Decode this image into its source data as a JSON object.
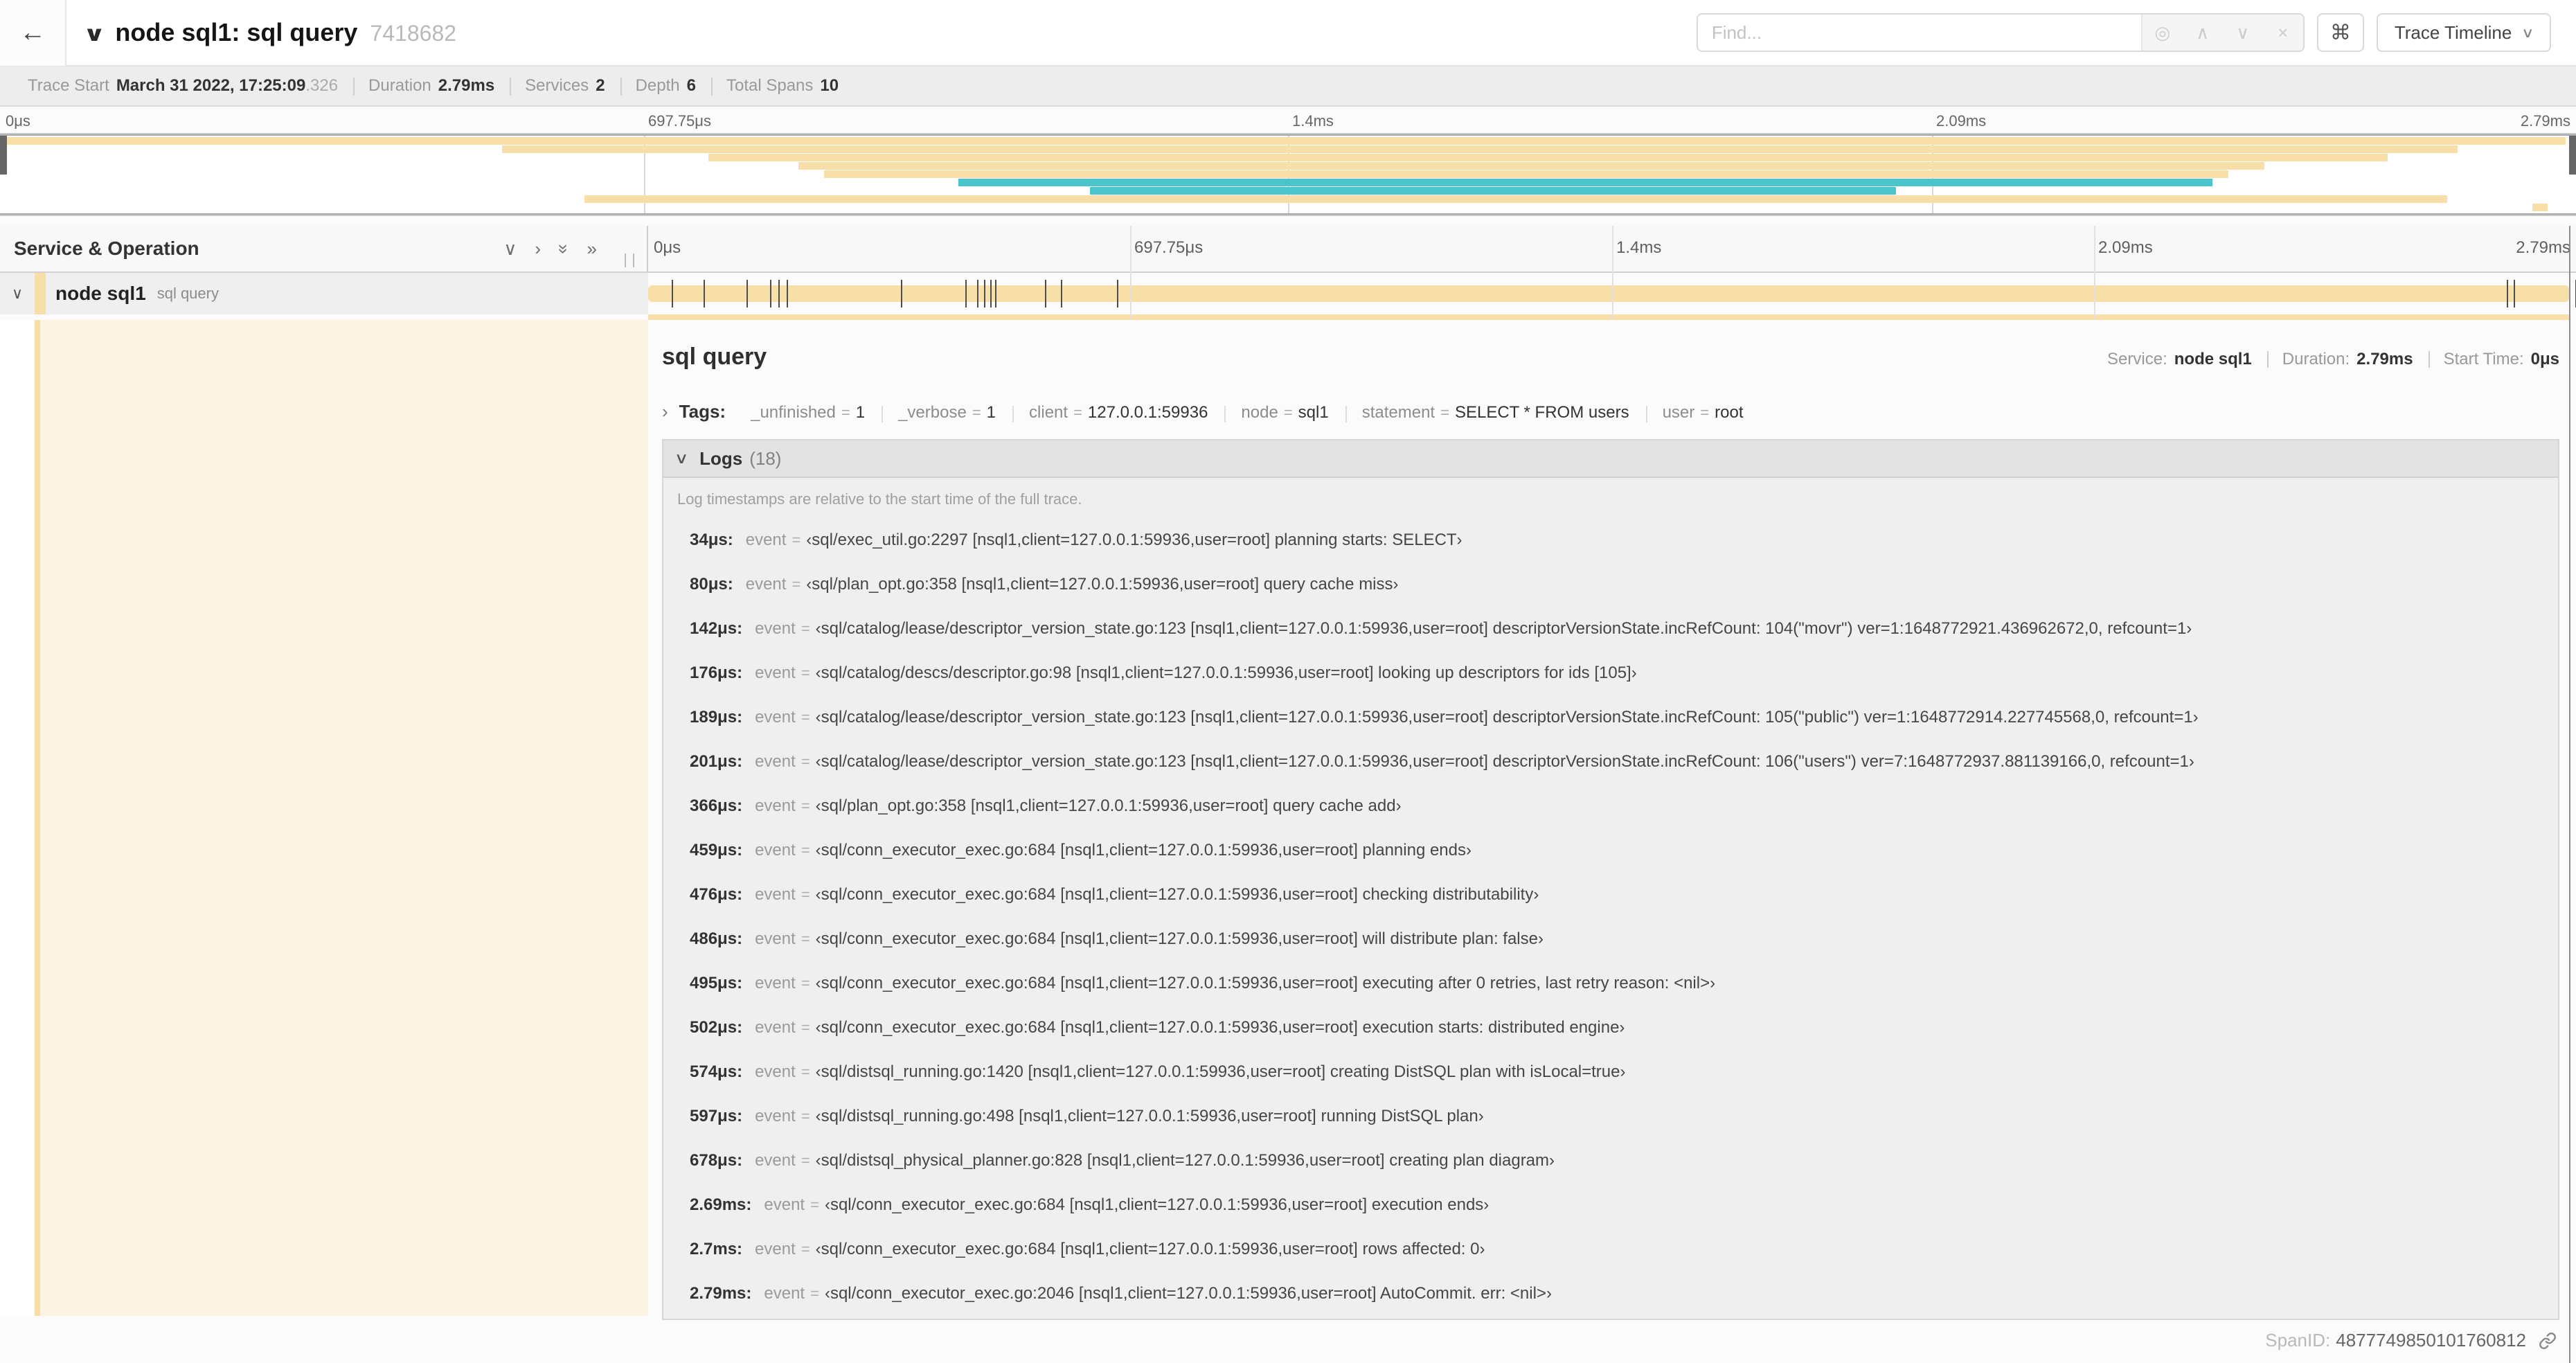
{
  "colors": {
    "tan": "#F8DEA8",
    "teal": "#49C5CB",
    "cream": "#FCF4E2"
  },
  "icons": {
    "back": "←",
    "title_collapse": "∨",
    "dropdown_chevron": "∨",
    "find_target": "◎",
    "find_prev": "∧",
    "find_next": "∨",
    "find_clear": "×",
    "shortcut": "⌘",
    "collapse_one": "∨",
    "expand_one": "›",
    "collapse_all": "»",
    "expand_all": "»",
    "row_chevron": "∨",
    "tags_chevron": "›",
    "logs_chevron": "∨",
    "log_chevron": "›"
  },
  "topbar": {
    "title": "node sql1: sql query",
    "trace_id": "7418682",
    "find_placeholder": "Find...",
    "view_selector": "Trace Timeline"
  },
  "stats": [
    {
      "label": "Trace Start",
      "value": "March 31 2022, 17:25:09",
      "suffix": ".326"
    },
    {
      "label": "Duration",
      "value": "2.79ms"
    },
    {
      "label": "Services",
      "value": "2"
    },
    {
      "label": "Depth",
      "value": "6"
    },
    {
      "label": "Total Spans",
      "value": "10"
    }
  ],
  "minimap": {
    "ticks": [
      {
        "label": "0μs",
        "pos": 0
      },
      {
        "label": "697.75μs",
        "pos": 25
      },
      {
        "label": "1.4ms",
        "pos": 50
      },
      {
        "label": "2.09ms",
        "pos": 75
      },
      {
        "label": "2.79ms",
        "pos": 100
      }
    ],
    "spans": [
      {
        "start": 0,
        "end": 99.6,
        "color": "tan"
      },
      {
        "start": 19.5,
        "end": 95.4,
        "color": "tan"
      },
      {
        "start": 27.5,
        "end": 92.7,
        "color": "tan"
      },
      {
        "start": 31.0,
        "end": 87.9,
        "color": "tan"
      },
      {
        "start": 32.0,
        "end": 86.5,
        "color": "tan"
      },
      {
        "start": 37.2,
        "end": 85.9,
        "color": "teal"
      },
      {
        "start": 42.3,
        "end": 73.6,
        "color": "teal"
      },
      {
        "start": 22.7,
        "end": 95.0,
        "color": "tan"
      },
      {
        "start": 98.3,
        "end": 98.9,
        "color": "tan"
      }
    ]
  },
  "grid": {
    "header": "Service & Operation"
  },
  "ruler": {
    "ticks": [
      {
        "label": "0μs",
        "pos": 0
      },
      {
        "label": "697.75μs",
        "pos": 25
      },
      {
        "label": "1.4ms",
        "pos": 50
      },
      {
        "label": "2.09ms",
        "pos": 75
      },
      {
        "label": "2.79ms",
        "pos": 100
      }
    ]
  },
  "row": {
    "service": "node sql1",
    "operation": "sql query"
  },
  "log_marks": [
    1.22,
    2.87,
    5.09,
    6.31,
    6.77,
    7.2,
    13.12,
    16.45,
    17.06,
    17.42,
    17.74,
    17.99,
    20.57,
    21.4,
    24.3,
    96.42,
    96.77,
    99.95
  ],
  "detail": {
    "title": "sql query",
    "overview": [
      {
        "label": "Service:",
        "value": "node sql1"
      },
      {
        "label": "Duration:",
        "value": "2.79ms"
      },
      {
        "label": "Start Time:",
        "value": "0μs"
      }
    ],
    "tags_label": "Tags:",
    "tags": [
      {
        "key": "_unfinished",
        "eq": "=",
        "value": "1"
      },
      {
        "key": "_verbose",
        "eq": "=",
        "value": "1"
      },
      {
        "key": "client",
        "eq": "=",
        "value": "127.0.0.1:59936"
      },
      {
        "key": "node",
        "eq": "=",
        "value": "sql1"
      },
      {
        "key": "statement",
        "eq": "=",
        "value": "SELECT * FROM users"
      },
      {
        "key": "user",
        "eq": "=",
        "value": "root"
      }
    ],
    "logs_label": "Logs",
    "logs_count": "(18)",
    "logs": [
      {
        "time": "34μs:",
        "key": "event",
        "eq": "=",
        "value": "‹sql/exec_util.go:2297 [nsql1,client=127.0.0.1:59936,user=root] planning starts: SELECT›"
      },
      {
        "time": "80μs:",
        "key": "event",
        "eq": "=",
        "value": "‹sql/plan_opt.go:358 [nsql1,client=127.0.0.1:59936,user=root] query cache miss›"
      },
      {
        "time": "142μs:",
        "key": "event",
        "eq": "=",
        "value": "‹sql/catalog/lease/descriptor_version_state.go:123 [nsql1,client=127.0.0.1:59936,user=root] descriptorVersionState.incRefCount: 104(\"movr\") ver=1:1648772921.436962672,0, refcount=1›"
      },
      {
        "time": "176μs:",
        "key": "event",
        "eq": "=",
        "value": "‹sql/catalog/descs/descriptor.go:98 [nsql1,client=127.0.0.1:59936,user=root] looking up descriptors for ids [105]›"
      },
      {
        "time": "189μs:",
        "key": "event",
        "eq": "=",
        "value": "‹sql/catalog/lease/descriptor_version_state.go:123 [nsql1,client=127.0.0.1:59936,user=root] descriptorVersionState.incRefCount: 105(\"public\") ver=1:1648772914.227745568,0, refcount=1›"
      },
      {
        "time": "201μs:",
        "key": "event",
        "eq": "=",
        "value": "‹sql/catalog/lease/descriptor_version_state.go:123 [nsql1,client=127.0.0.1:59936,user=root] descriptorVersionState.incRefCount: 106(\"users\") ver=7:1648772937.881139166,0, refcount=1›"
      },
      {
        "time": "366μs:",
        "key": "event",
        "eq": "=",
        "value": "‹sql/plan_opt.go:358 [nsql1,client=127.0.0.1:59936,user=root] query cache add›"
      },
      {
        "time": "459μs:",
        "key": "event",
        "eq": "=",
        "value": "‹sql/conn_executor_exec.go:684 [nsql1,client=127.0.0.1:59936,user=root] planning ends›"
      },
      {
        "time": "476μs:",
        "key": "event",
        "eq": "=",
        "value": "‹sql/conn_executor_exec.go:684 [nsql1,client=127.0.0.1:59936,user=root] checking distributability›"
      },
      {
        "time": "486μs:",
        "key": "event",
        "eq": "=",
        "value": "‹sql/conn_executor_exec.go:684 [nsql1,client=127.0.0.1:59936,user=root] will distribute plan: false›"
      },
      {
        "time": "495μs:",
        "key": "event",
        "eq": "=",
        "value": "‹sql/conn_executor_exec.go:684 [nsql1,client=127.0.0.1:59936,user=root] executing after 0 retries, last retry reason: <nil>›"
      },
      {
        "time": "502μs:",
        "key": "event",
        "eq": "=",
        "value": "‹sql/conn_executor_exec.go:684 [nsql1,client=127.0.0.1:59936,user=root] execution starts: distributed engine›"
      },
      {
        "time": "574μs:",
        "key": "event",
        "eq": "=",
        "value": "‹sql/distsql_running.go:1420 [nsql1,client=127.0.0.1:59936,user=root] creating DistSQL plan with isLocal=true›"
      },
      {
        "time": "597μs:",
        "key": "event",
        "eq": "=",
        "value": "‹sql/distsql_running.go:498 [nsql1,client=127.0.0.1:59936,user=root] running DistSQL plan›"
      },
      {
        "time": "678μs:",
        "key": "event",
        "eq": "=",
        "value": "‹sql/distsql_physical_planner.go:828 [nsql1,client=127.0.0.1:59936,user=root] creating plan diagram›"
      },
      {
        "time": "2.69ms:",
        "key": "event",
        "eq": "=",
        "value": "‹sql/conn_executor_exec.go:684 [nsql1,client=127.0.0.1:59936,user=root] execution ends›"
      },
      {
        "time": "2.7ms:",
        "key": "event",
        "eq": "=",
        "value": "‹sql/conn_executor_exec.go:684 [nsql1,client=127.0.0.1:59936,user=root] rows affected: 0›"
      },
      {
        "time": "2.79ms:",
        "key": "event",
        "eq": "=",
        "value": "‹sql/conn_executor_exec.go:2046 [nsql1,client=127.0.0.1:59936,user=root] AutoCommit. err: <nil>›"
      }
    ],
    "footnote": "Log timestamps are relative to the start time of the full trace.",
    "spanid_label": "SpanID:",
    "spanid": "4877749850101760812"
  }
}
